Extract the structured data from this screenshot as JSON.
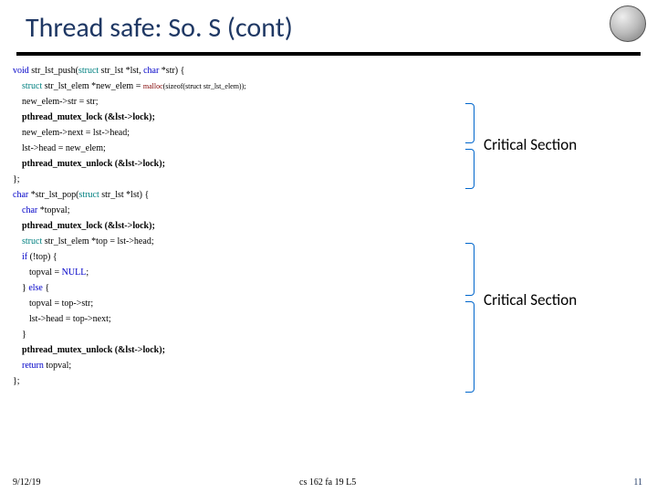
{
  "title": "Thread safe: So. S (cont)",
  "code": {
    "l1a": "void",
    "l1b": " str_lst_push(",
    "l1c": "struct",
    "l1d": " str_lst *lst, ",
    "l1e": "char",
    "l1f": " *str) {",
    "l2a": "struct",
    "l2b": " str_lst_elem *new_elem = ",
    "l2c": "malloc",
    "l2d": "(sizeof(struct str_lst_elem));",
    "l3": "new_elem->str = str;",
    "l4": "pthread_mutex_lock (&lst->lock);",
    "l5": "new_elem->next = lst->head;",
    "l6": "lst->head = new_elem;",
    "l7": "pthread_mutex_unlock (&lst->lock);",
    "l8": "};",
    "l9a": "char",
    "l9b": " *str_lst_pop(",
    "l9c": "struct",
    "l9d": " str_lst *lst) {",
    "l10a": "char",
    "l10b": " *topval;",
    "l11": "pthread_mutex_lock (&lst->lock);",
    "l12a": "struct",
    "l12b": " str_lst_elem *top = lst->head;",
    "l13a": "if",
    "l13b": " (!top) {",
    "l14a": "topval = ",
    "l14b": "NULL",
    "l14c": ";",
    "l15a": "} ",
    "l15b": "else",
    "l15c": " {",
    "l16": "topval = top->str;",
    "l17": "lst->head = top->next;",
    "l18": "}",
    "l19": "pthread_mutex_unlock (&lst->lock);",
    "l20a": "return",
    "l20b": " topval;",
    "l21": "};"
  },
  "critical_label": "Critical Section",
  "footer": {
    "date": "9/12/19",
    "mid": "cs 162 fa 19 L5",
    "page": "11"
  }
}
